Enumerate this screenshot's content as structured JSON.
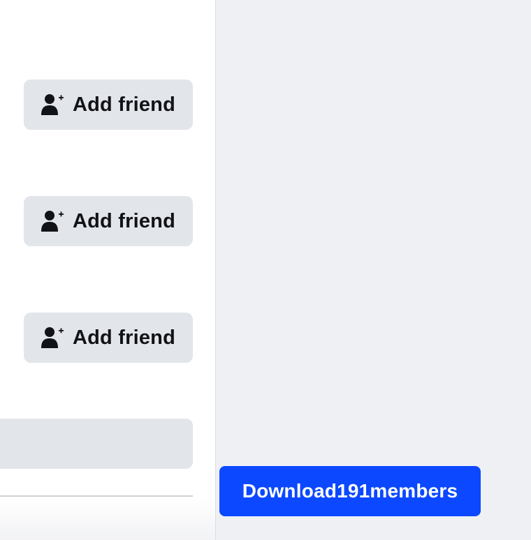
{
  "buttons": {
    "add_friend_label": "Add friend",
    "download_label": "Download191members"
  },
  "icons": {
    "add_friend": "person-plus-icon"
  },
  "colors": {
    "download_accent": "#0b48ff",
    "button_grey": "#e2e5e9",
    "background": "#eff0f4"
  }
}
